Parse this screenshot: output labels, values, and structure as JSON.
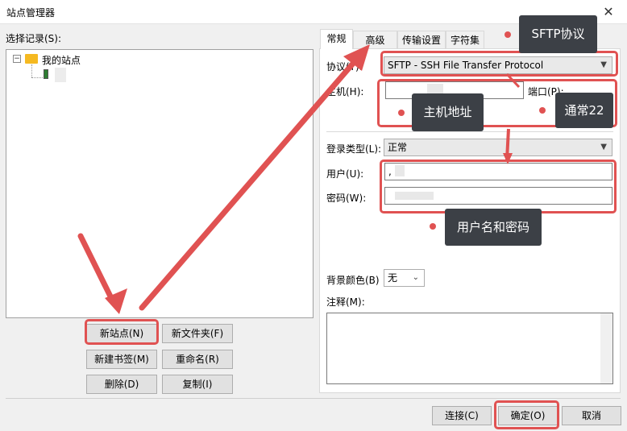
{
  "window": {
    "title": "站点管理器",
    "close_glyph": "✕"
  },
  "left": {
    "select_label": "选择记录(S):",
    "tree": {
      "root_label": "我的站点",
      "expand_glyph": "−"
    },
    "buttons": {
      "new_site": "新站点(N)",
      "new_folder": "新文件夹(F)",
      "new_bookmark": "新建书签(M)",
      "rename": "重命名(R)",
      "delete": "删除(D)",
      "copy": "复制(I)"
    }
  },
  "tabs": [
    "常规",
    "高级",
    "传输设置",
    "字符集"
  ],
  "general": {
    "protocol_label": "协议(T):",
    "protocol_value": "SFTP - SSH File Transfer Protocol",
    "host_label": "主机(H):",
    "port_label": "端口(P):",
    "logon_type_label": "登录类型(L):",
    "logon_type_value": "正常",
    "user_label": "用户(U):",
    "user_value": ",",
    "password_label": "密码(W):",
    "bg_color_label": "背景颜色(B)",
    "bg_color_value": "无",
    "comments_label": "注释(M):"
  },
  "bottom_buttons": {
    "connect": "连接(C)",
    "ok": "确定(O)",
    "cancel": "取消"
  },
  "annotations": {
    "sftp": "SFTP协议",
    "host": "主机地址",
    "port": "通常22",
    "credentials": "用户名和密码"
  },
  "colors": {
    "highlight": "#e05252",
    "callout_bg": "#3c4046",
    "folder": "#f5b921"
  }
}
